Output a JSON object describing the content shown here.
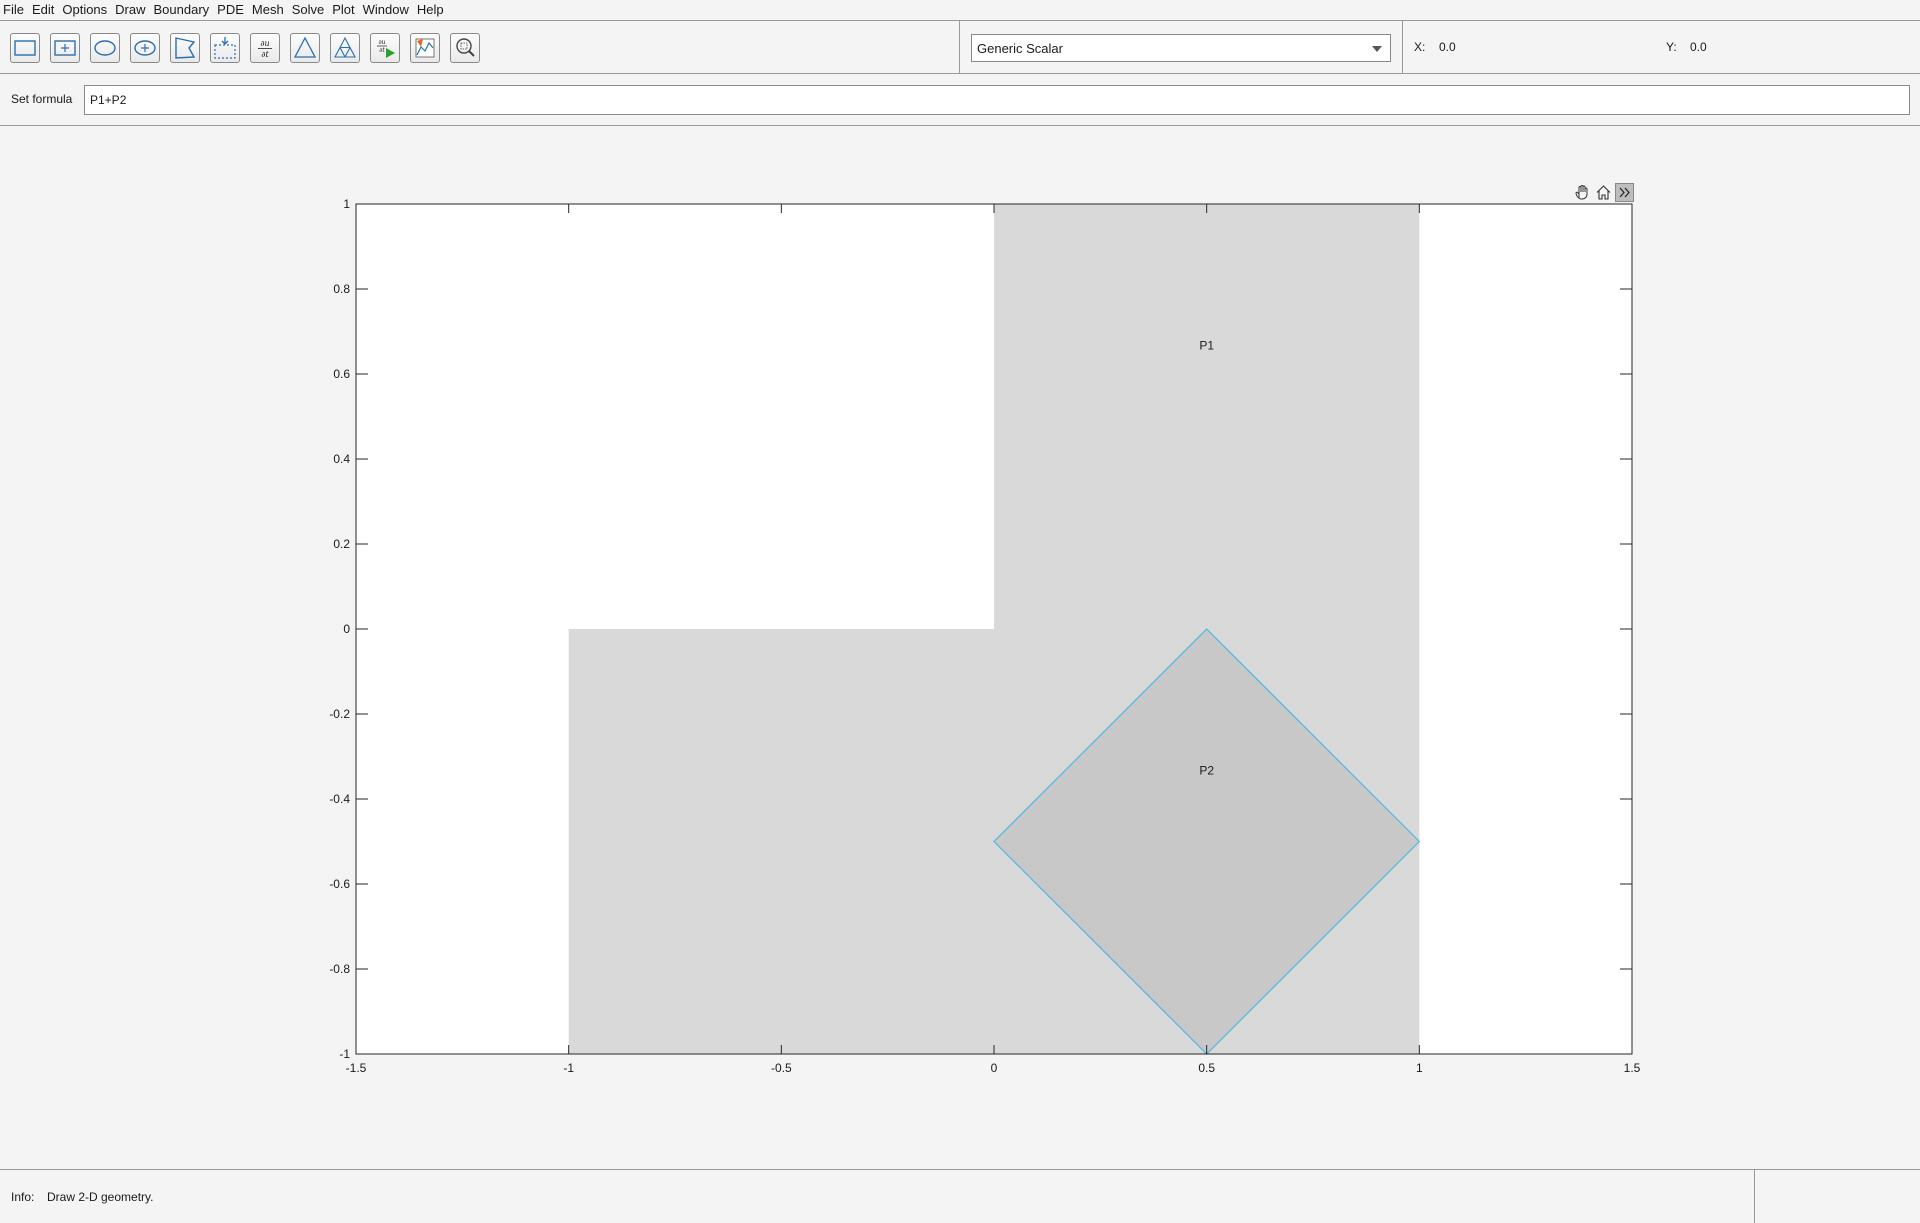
{
  "menu": [
    "File",
    "Edit",
    "Options",
    "Draw",
    "Boundary",
    "PDE",
    "Mesh",
    "Solve",
    "Plot",
    "Window",
    "Help"
  ],
  "toolbar": {
    "icons": [
      "rectangle-icon",
      "centered-rectangle-icon",
      "ellipse-icon",
      "centered-ellipse-icon",
      "polygon-icon",
      "boundary-mode-icon",
      "pde-coefficients-icon",
      "mesh-icon",
      "refine-mesh-icon",
      "solve-pde-icon",
      "plot-solution-icon",
      "zoom-icon"
    ],
    "application_mode": "Generic Scalar",
    "x_label": "X:",
    "x_value": "0.0",
    "y_label": "Y:",
    "y_value": "0.0"
  },
  "formula": {
    "label": "Set formula",
    "value": "P1+P2"
  },
  "axes_toolbar": {
    "icons": [
      "pan-hand-icon",
      "home-icon",
      "expand-icon"
    ]
  },
  "chart_data": {
    "type": "geometry",
    "xlim": [
      -1.5,
      1.5
    ],
    "ylim": [
      -1,
      1
    ],
    "x_ticks": [
      -1.5,
      -1,
      -0.5,
      0,
      0.5,
      1,
      1.5
    ],
    "x_tick_labels": [
      "-1.5",
      "-1",
      "-0.5",
      "0",
      "0.5",
      "1",
      "1.5"
    ],
    "y_ticks": [
      -1,
      -0.8,
      -0.6,
      -0.4,
      -0.2,
      0,
      0.2,
      0.4,
      0.6,
      0.8,
      1
    ],
    "y_tick_labels": [
      "-1",
      "-0.8",
      "-0.6",
      "-0.4",
      "-0.2",
      "0",
      "0.2",
      "0.4",
      "0.6",
      "0.8",
      "1"
    ],
    "shapes": [
      {
        "name": "P1",
        "label": "P1",
        "points": [
          [
            -1,
            -1
          ],
          [
            1,
            -1
          ],
          [
            1,
            1
          ],
          [
            0,
            1
          ],
          [
            0,
            0
          ],
          [
            -1,
            0
          ]
        ],
        "label_at": [
          0.5,
          0.667
        ],
        "fill": "#d9d9d9",
        "stroke": "none"
      },
      {
        "name": "P2",
        "label": "P2",
        "points": [
          [
            0.5,
            0
          ],
          [
            1,
            -0.5
          ],
          [
            0.5,
            -1
          ],
          [
            0,
            -0.5
          ]
        ],
        "label_at": [
          0.5,
          -0.333
        ],
        "fill": "#c8c8c8",
        "stroke": "#4eb8e0"
      }
    ]
  },
  "status": {
    "label": "Info:",
    "text": "Draw 2-D geometry."
  }
}
